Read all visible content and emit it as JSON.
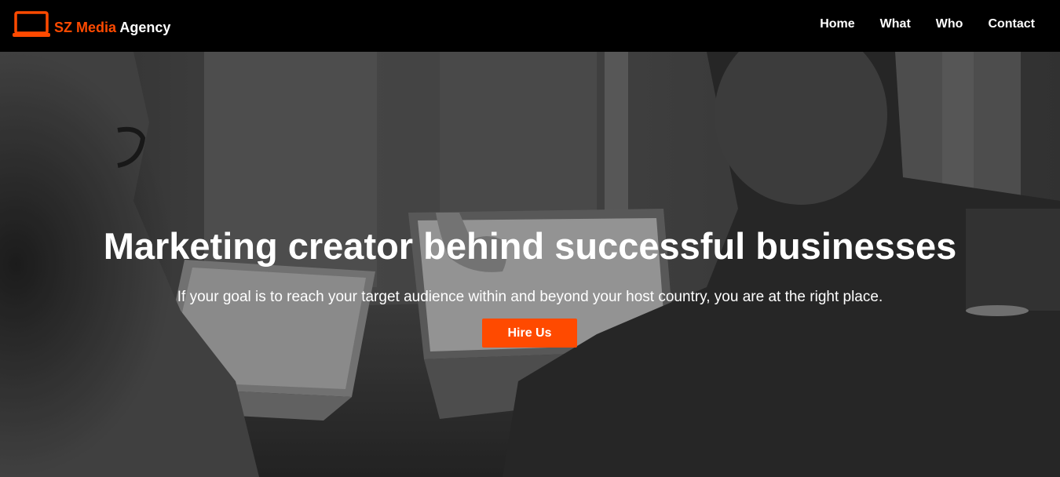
{
  "brand": {
    "accent_text": "SZ Media",
    "rest_text": "Agency",
    "icon": "laptop-icon",
    "accent_color": "#ff4a00"
  },
  "nav": {
    "items": [
      {
        "label": "Home"
      },
      {
        "label": "What"
      },
      {
        "label": "Who"
      },
      {
        "label": "Contact"
      }
    ]
  },
  "hero": {
    "title": "Marketing creator behind successful businesses",
    "subtitle": "If your goal is to reach your target audience within and beyond your host country, you are at the right place.",
    "button_label": "Hire Us",
    "button_color": "#ff4a00",
    "background": "grayscale office photo"
  }
}
